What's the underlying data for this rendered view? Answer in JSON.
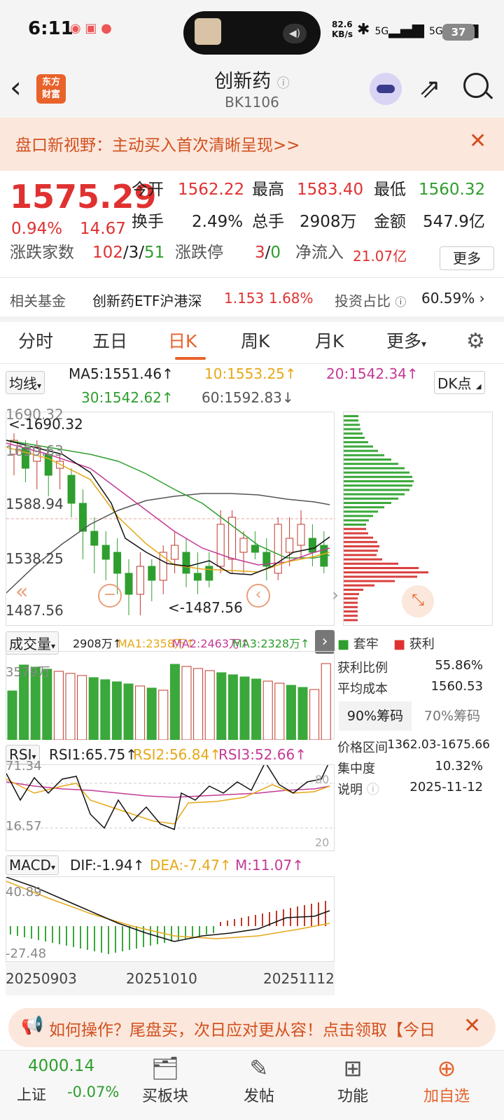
{
  "status": {
    "time": "6:11",
    "speed": "82.6",
    "speed_unit": "KB/s",
    "sig1": "5G",
    "sig2": "5G",
    "battery": "37"
  },
  "header": {
    "title": "创新药",
    "code": "BK1106",
    "logo_l1": "东方",
    "logo_l2": "财富"
  },
  "banner": {
    "text": "盘口新视野：主动买入首次清晰呈现>>"
  },
  "quote": {
    "price": "1575.29",
    "pct": "0.94%",
    "chg": "14.67",
    "open_l": "今开",
    "open": "1562.22",
    "high_l": "最高",
    "high": "1583.40",
    "low_l": "最低",
    "low": "1560.32",
    "turn_l": "换手",
    "turn": "2.49%",
    "vol_l": "总手",
    "vol": "2908万",
    "amt_l": "金额",
    "amt": "547.9亿",
    "ud_l": "涨跌家数",
    "up": "102",
    "flat": "3",
    "down": "51",
    "lim_l": "涨跌停",
    "lim_up": "3",
    "lim_down": "0",
    "flow_l": "净流入",
    "flow": "21.07亿",
    "more": "更多"
  },
  "fund": {
    "label": "相关基金",
    "name": "创新药ETF沪港深",
    "price": "1.153",
    "pct": "1.68%",
    "ratio_l": "投资占比",
    "ratio": "60.59%"
  },
  "tabs": [
    "分时",
    "五日",
    "日K",
    "周K",
    "月K",
    "更多"
  ],
  "ma": {
    "sel": "均线",
    "ma5": "MA5:1551.46",
    "ma10": "10:1553.25",
    "ma20": "20:1542.34",
    "ma30": "30:1542.62",
    "ma60": "60:1592.83",
    "dk": "DK点"
  },
  "kchart": {
    "top": "1690.32",
    "top_tag": "<-1690.32",
    "l2": "1639.63",
    "l3": "1588.94",
    "l4": "1538.25",
    "bottom": "1487.56",
    "low_tag": "<-1487.56",
    "colors": {
      "up": "#c0392b",
      "down": "#2e9e2e"
    }
  },
  "dist": {
    "trap": "套牢",
    "profit": "获利",
    "profit_ratio_l": "获利比例",
    "profit_ratio": "55.86%",
    "avg_l": "平均成本",
    "avg": "1560.53",
    "c90": "90%筹码",
    "c70": "70%筹码",
    "range_l": "价格区间",
    "range": "1362.03-1675.66",
    "conc_l": "集中度",
    "conc": "10.32%",
    "note_l": "说明",
    "note": "2025-11-12"
  },
  "volume": {
    "sel": "成交量",
    "v": "2908万",
    "ma1": "MA1:2358万",
    "ma2": "MA2:2463万",
    "ma3": "MA3:2328万",
    "top": "3579万"
  },
  "rsi": {
    "sel": "RSI",
    "r1": "RSI1:65.75",
    "r2": "RSI2:56.84",
    "r3": "RSI3:52.66",
    "top": "71.34",
    "bottom": "16.57",
    "m80": "80",
    "m20": "20"
  },
  "macd": {
    "sel": "MACD",
    "dif": "DIF:-1.94",
    "dea": "DEA:-7.47",
    "m": "M:11.07",
    "top": "40.89",
    "bottom": "-27.48"
  },
  "dates": [
    "20250903",
    "20251010",
    "20251112"
  ],
  "ad": {
    "text": "如何操作？尾盘买，次日应对更从容！点击领取【今日"
  },
  "bottom": {
    "index": "4000.14",
    "index_name": "上证",
    "index_pct": "-0.07%",
    "nav": [
      "买板块",
      "发帖",
      "功能",
      "加自选"
    ]
  }
}
